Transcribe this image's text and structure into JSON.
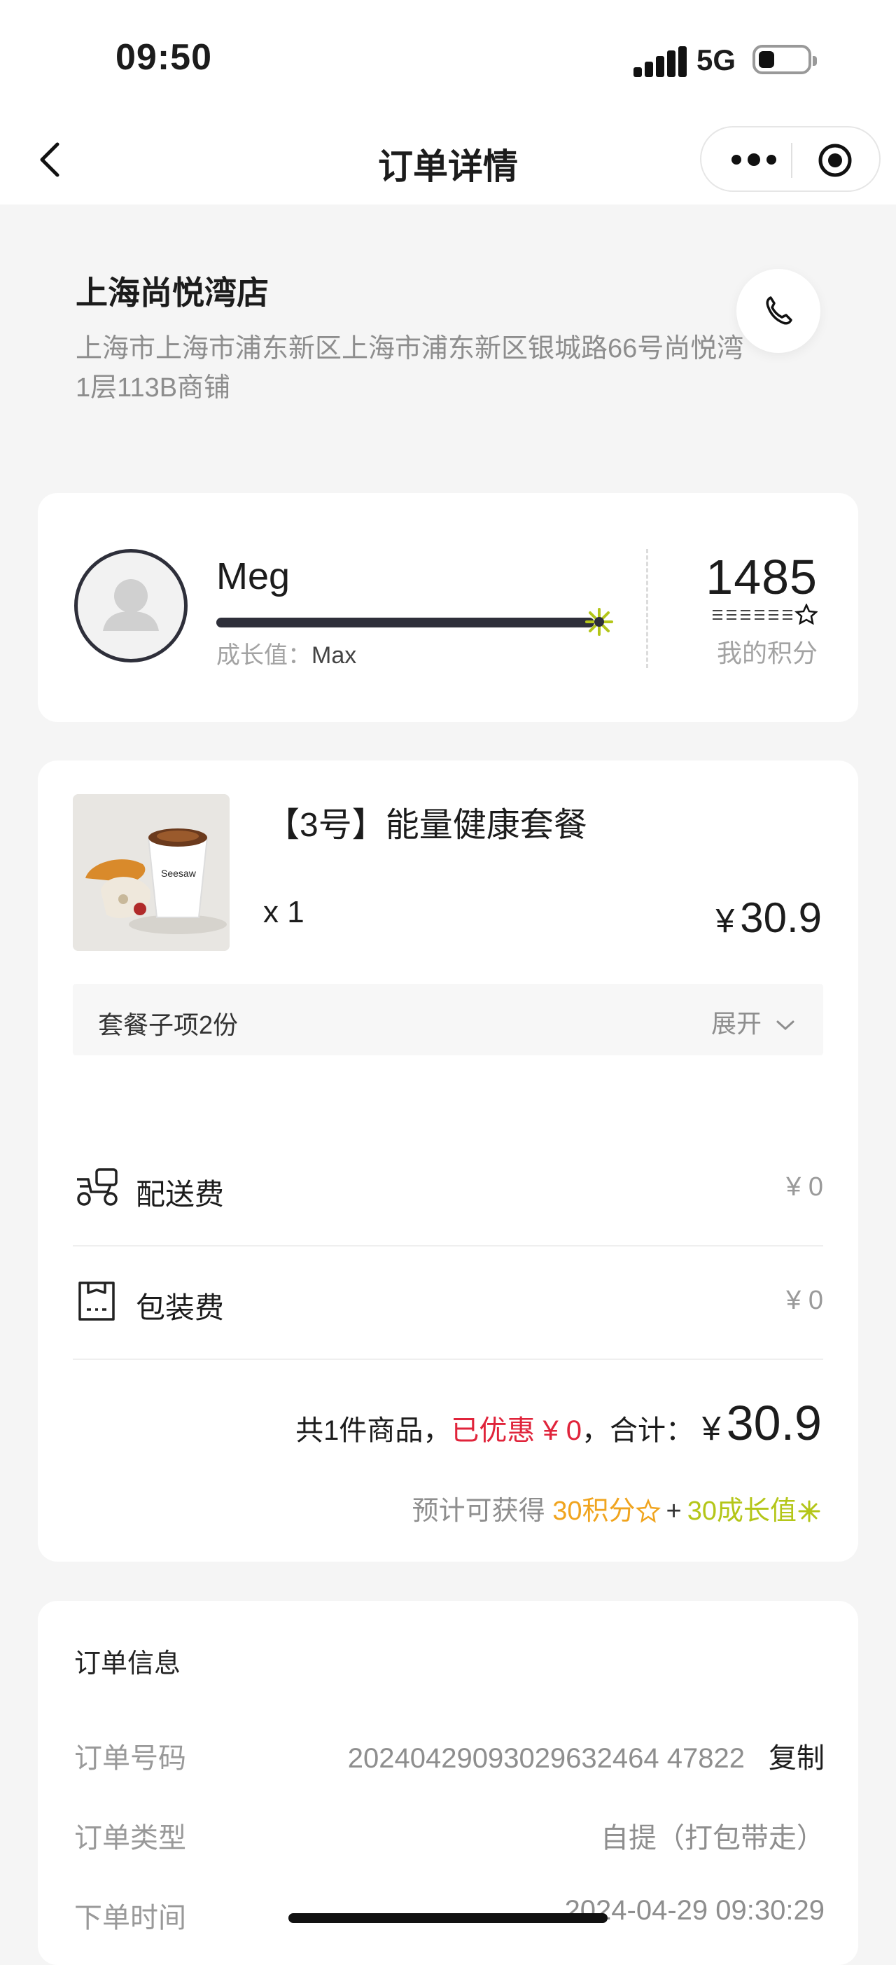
{
  "status_bar": {
    "time": "09:50",
    "network": "5G",
    "battery_level": 0.2
  },
  "nav": {
    "title": "订单详情",
    "back_icon": "chevron-left-icon",
    "more_icon": "more-dots-icon",
    "target_icon": "target-icon"
  },
  "store": {
    "name": "上海尚悦湾店",
    "address": "上海市上海市浦东新区上海市浦东新区银城路66号尚悦湾1层113B商铺",
    "phone_icon": "phone-icon"
  },
  "member": {
    "name": "Meg",
    "growth_label": "成长值：",
    "growth_value": "Max",
    "growth_progress": 1.0,
    "points": "1485",
    "points_label": "我的积分"
  },
  "product": {
    "name": "【3号】能量健康套餐",
    "quantity": "x 1",
    "currency": "¥",
    "price": "30.9",
    "combo_label": "套餐子项2份",
    "expand_label": "展开"
  },
  "fees": [
    {
      "label": "配送费",
      "value": "¥ 0",
      "icon": "delivery-scooter-icon"
    },
    {
      "label": "包装费",
      "value": "¥ 0",
      "icon": "package-bag-icon"
    }
  ],
  "summary": {
    "items_text": "共1件商品，",
    "discount_text": "已优惠 ¥ 0",
    "total_label": "，合计：",
    "currency": "¥",
    "total": "30.9",
    "earn_prefix": "预计可获得 ",
    "earn_points": "30积分",
    "earn_plus": "+",
    "earn_growth": "30成长值"
  },
  "order_info": {
    "title": "订单信息",
    "rows": [
      {
        "label": "订单号码",
        "value": "20240429093029632464 47822",
        "action": "复制"
      },
      {
        "label": "订单类型",
        "value": "自提（打包带走）"
      },
      {
        "label": "下单时间",
        "value": "2024-04-29 09:30:29"
      }
    ]
  },
  "colors": {
    "discount": "#e0243b",
    "points": "#f0a41e",
    "growth": "#b4c619",
    "dark": "#2e2f3a"
  }
}
